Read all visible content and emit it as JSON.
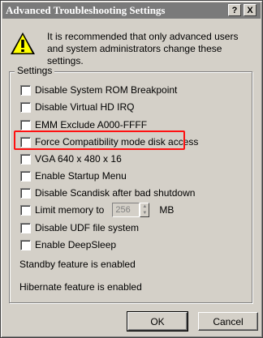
{
  "window": {
    "title": "Advanced Troubleshooting Settings",
    "help_glyph": "?",
    "close_glyph": "X"
  },
  "intro": {
    "text": "It is recommended that only advanced users and system administrators change these settings.",
    "icon": "warning-icon",
    "icon_color": "#ffff00"
  },
  "settings": {
    "group_label": "Settings",
    "options": [
      {
        "label": "Disable System ROM Breakpoint",
        "checked": false
      },
      {
        "label": "Disable Virtual HD IRQ",
        "checked": false
      },
      {
        "label": "EMM Exclude A000-FFFF",
        "checked": false
      },
      {
        "label": "Force Compatibility mode disk access",
        "checked": false
      },
      {
        "label": "VGA 640 x 480 x 16",
        "checked": false
      },
      {
        "label": "Enable Startup Menu",
        "checked": false
      },
      {
        "label": "Disable Scandisk after bad shutdown",
        "checked": false
      },
      {
        "label": "Limit memory to",
        "checked": false
      },
      {
        "label": "Disable UDF file system",
        "checked": false
      },
      {
        "label": "Enable DeepSleep",
        "checked": false
      }
    ],
    "memory_value": "256",
    "memory_unit": "MB",
    "status_standby": "Standby feature is enabled",
    "status_hibernate": "Hibernate feature is enabled",
    "highlight_color": "#ff1010"
  },
  "buttons": {
    "ok": "OK",
    "cancel": "Cancel"
  }
}
